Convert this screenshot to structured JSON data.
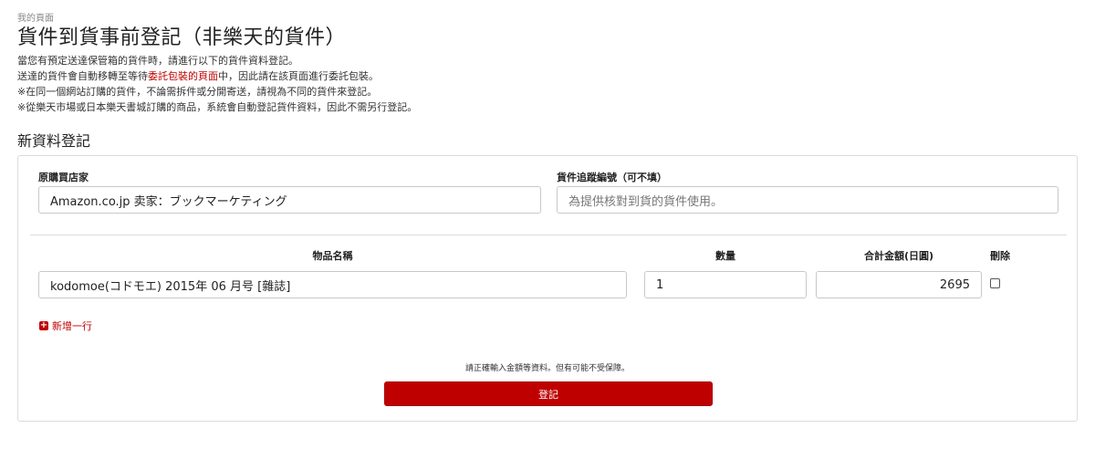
{
  "breadcrumb": "我的頁面",
  "page_title": "貨件到貨事前登記（非樂天的貨件）",
  "intro": {
    "line1": "當您有預定送達保管箱的貨件時，請進行以下的貨件資料登記。",
    "line2_before": "送達的貨件會自動移轉至等待",
    "line2_link": "委託包裝的頁面",
    "line2_after": "中，因此請在該頁面進行委託包裝。",
    "line3": "※在同一個網站訂購的貨件，不論需拆件或分開寄送，請視為不同的貨件來登記。",
    "line4": "※從樂天市場或日本樂天書城訂購的商品，系統會自動登記貨件資料，因此不需另行登記。"
  },
  "section_title": "新資料登記",
  "form": {
    "store_label": "原購買店家",
    "store_value": "Amazon.co.jp 卖家：ブックマーケティング",
    "tracking_label": "貨件追蹤編號（可不填）",
    "tracking_placeholder": "為提供核對到貨的貨件使用。",
    "columns": {
      "name": "物品名稱",
      "qty": "數量",
      "total": "合計金額(日圓)",
      "delete": "刪除"
    },
    "items": [
      {
        "name": "kodomoe(コドモエ) 2015年 06 月号 [雜誌]",
        "qty": "1",
        "total": "2695",
        "delete_checked": false
      }
    ],
    "add_row_label": "新增一行",
    "notice": "請正確輸入金額等資料。但有可能不受保障。",
    "submit_label": "登記"
  },
  "colors": {
    "accent": "#bf0000",
    "border": "#c8c8c8"
  }
}
